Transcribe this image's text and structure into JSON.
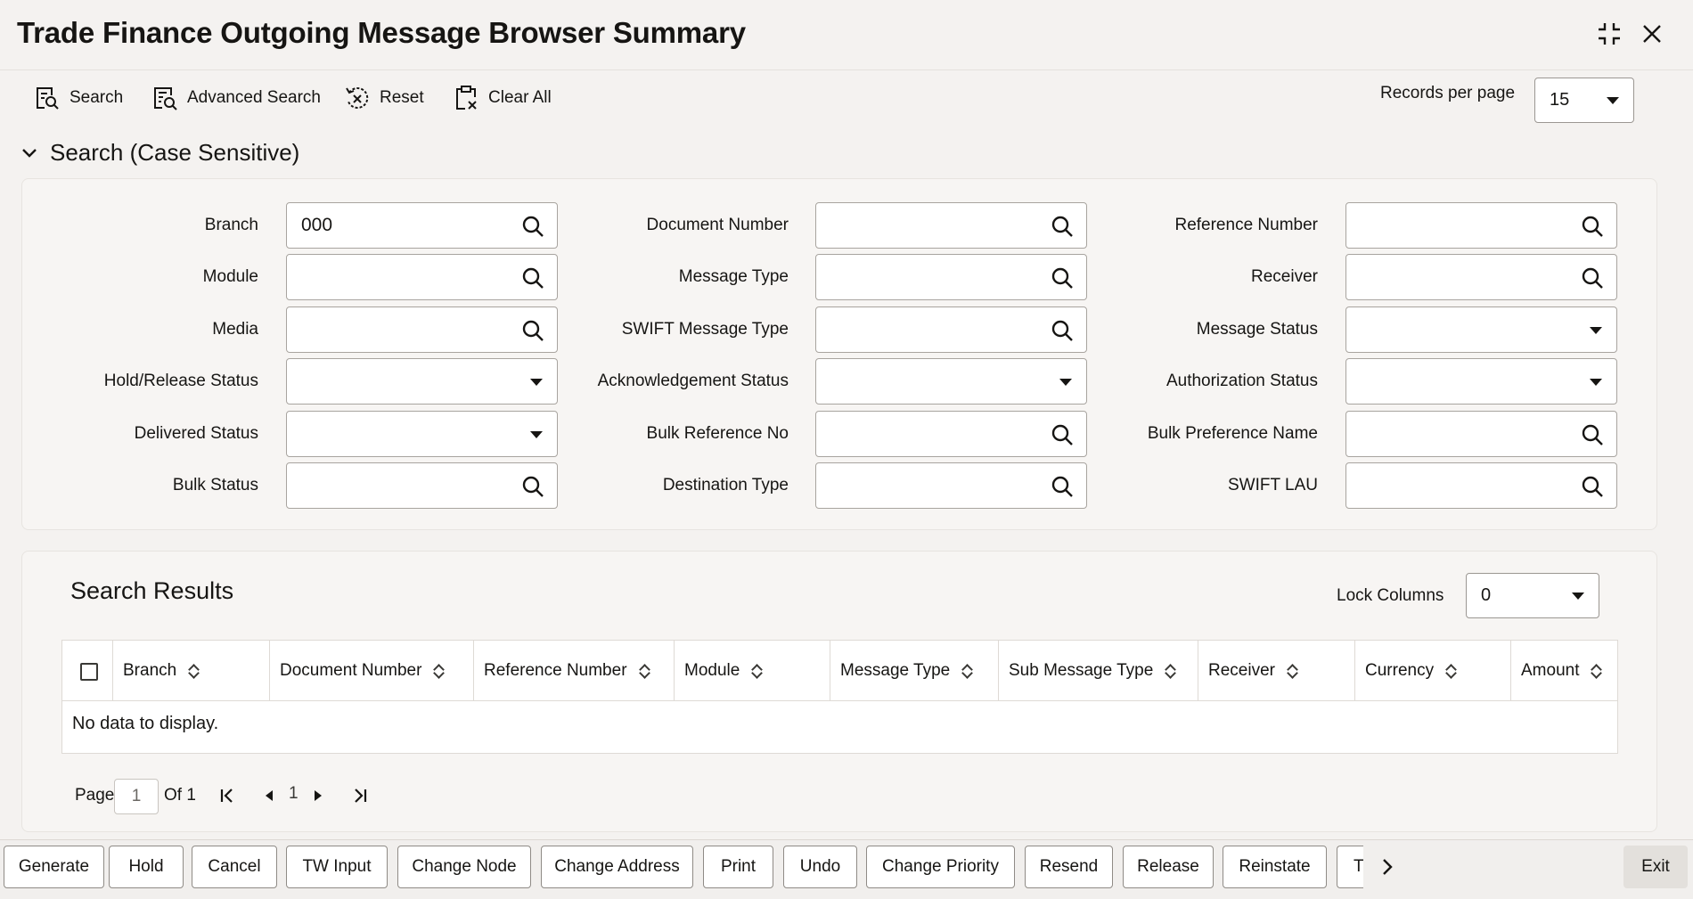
{
  "window": {
    "title": "Trade Finance Outgoing Message Browser Summary"
  },
  "toolbar": {
    "search": "Search",
    "advanced_search": "Advanced Search",
    "reset": "Reset",
    "clear_all": "Clear All",
    "records_per_page_label": "Records per page",
    "records_per_page_value": "15"
  },
  "search_section": {
    "title": "Search (Case Sensitive)",
    "fields": {
      "branch": {
        "label": "Branch",
        "value": "000"
      },
      "document_number": {
        "label": "Document Number",
        "value": ""
      },
      "reference_number": {
        "label": "Reference Number",
        "value": ""
      },
      "module": {
        "label": "Module",
        "value": ""
      },
      "message_type": {
        "label": "Message Type",
        "value": ""
      },
      "receiver": {
        "label": "Receiver",
        "value": ""
      },
      "media": {
        "label": "Media",
        "value": ""
      },
      "swift_message_type": {
        "label": "SWIFT Message Type",
        "value": ""
      },
      "message_status": {
        "label": "Message Status",
        "value": ""
      },
      "hold_release_status": {
        "label": "Hold/Release Status",
        "value": ""
      },
      "acknowledgement_status": {
        "label": "Acknowledgement Status",
        "value": ""
      },
      "authorization_status": {
        "label": "Authorization Status",
        "value": ""
      },
      "delivered_status": {
        "label": "Delivered Status",
        "value": ""
      },
      "bulk_reference_no": {
        "label": "Bulk Reference No",
        "value": ""
      },
      "bulk_preference_name": {
        "label": "Bulk Preference Name",
        "value": ""
      },
      "bulk_status": {
        "label": "Bulk Status",
        "value": ""
      },
      "destination_type": {
        "label": "Destination Type",
        "value": ""
      },
      "swift_lau": {
        "label": "SWIFT LAU",
        "value": ""
      }
    }
  },
  "results": {
    "title": "Search Results",
    "lock_columns_label": "Lock Columns",
    "lock_columns_value": "0",
    "columns": [
      "Branch",
      "Document Number",
      "Reference Number",
      "Module",
      "Message Type",
      "Sub Message Type",
      "Receiver",
      "Currency",
      "Amount"
    ],
    "empty_text": "No data to display.",
    "pager": {
      "page_label": "Page",
      "page_value": "1",
      "of_label": "Of 1",
      "current": "1"
    }
  },
  "footer": {
    "buttons": [
      "Generate",
      "Hold",
      "Cancel",
      "TW Input",
      "Change Node",
      "Change Address",
      "Print",
      "Undo",
      "Change Priority",
      "Resend",
      "Release",
      "Reinstate",
      "T"
    ],
    "exit": "Exit"
  },
  "colors": {
    "background": "#f4f2f0",
    "panel": "#f7f5f3",
    "text": "#161513",
    "border": "#a8a49f"
  }
}
